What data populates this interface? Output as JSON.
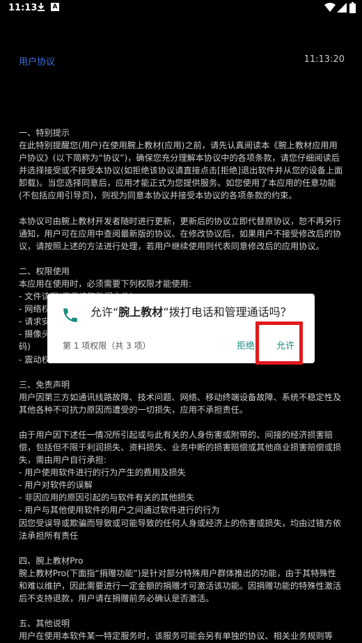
{
  "status_bar": {
    "time": "11:13",
    "badge": "A"
  },
  "header": {
    "title": "用户协议",
    "clock": "11:13:20"
  },
  "agreement": {
    "sections": [
      {
        "heading": "一、特别提示",
        "text": "在此特别提醒您(用户)在使用腕上教材(应用)之前，请先认真阅读本《腕上教材应用用户协议》(以下简称为“协议”)，确保您充分理解本协议中的各项条款，请您仔细阅读后并选择接受或不接受本协议(如拒绝该协议请直接点击[拒绝]退出软件并从您的设备上面卸载)。当您选择同意后，应用才能正式为您提供服务。如您使用了本应用的任意功能(不包括应用引导页)，则视为同意本协议并接受本协议的各项条款的约束。"
      },
      {
        "heading": "",
        "text": "本协议可由腕上教材开发者随时进行更新，更新后的协议立即代替原协议，恕不再另行通知，用户可在应用中查阅最新版的协议。在修改协议后，如果用户不接受修改后的协议，请按照上述的方法进行处理，若用户继续使用则代表同意修改后的应用协议。"
      },
      {
        "heading": "二、权限使用",
        "text": "本应用在使用时，必须需要下列权限才能使用:\n- 文件读写(用于读取数据文件)\n- 网络权\n- 请求安\n- 摄像头                                                                                                                          生成二维\n码)\n- 震动权"
      },
      {
        "heading": "三、免责声明",
        "text": "用户因第三方如通讯线路故障、技术问题、网络、移动终端设备故障、系统不稳定性及其他各种不可抗力原因而遭受的一切损失，应用不承担责任。"
      },
      {
        "heading": "",
        "text": "由于用户因下述任一情况所引起或与此有关的人身伤害或附带的、间接的经济损害赔偿，包括但不限于利润损失、资料损失、业务中断的损害赔偿或其他商业损害赔偿或损失，需由用户自行承担:\n- 用户使用软件进行的行为产生的费用及损失\n- 用户对软件的误解\n- 非因应用的原因引起的与软件有关的其他损失\n- 用户与其他使用软件的用户之间通过软件进行的行为\n因您受误导或欺骗而导致或可能导致的任何人身或经济上的伤害或损失，均由过错方依法承担所有责任"
      },
      {
        "heading": "四、腕上教材Pro",
        "text": "腕上教材Pro(下面指“捐赠功能”)是针对部分特殊用户群体推出的功能，由于其特殊性和难以维护，因此需要进行一定金额的捐赠才可激活该功能。因捐赠功能的特殊性激活后不支持退款，用户请在捐赠前务必确认是否激活。"
      },
      {
        "heading": "五、其他说明",
        "text": "用户在使用本软件某一特定服务时，该服务可能会另有单独的协议、相关业务规则等（以下统称为“单独协议”），您在使用该项服务前请阅读并同意相关的单独协议。"
      }
    ]
  },
  "dialog": {
    "title_prefix": "允许“",
    "app_name": "腕上教材",
    "title_suffix": "”拨打电话和管理通话吗？",
    "count": "第 1 项权限（共 3 项）",
    "deny_label": "拒绝",
    "allow_label": "允许",
    "accent_color": "#1a8a80",
    "highlight_color": "#e1191d"
  }
}
